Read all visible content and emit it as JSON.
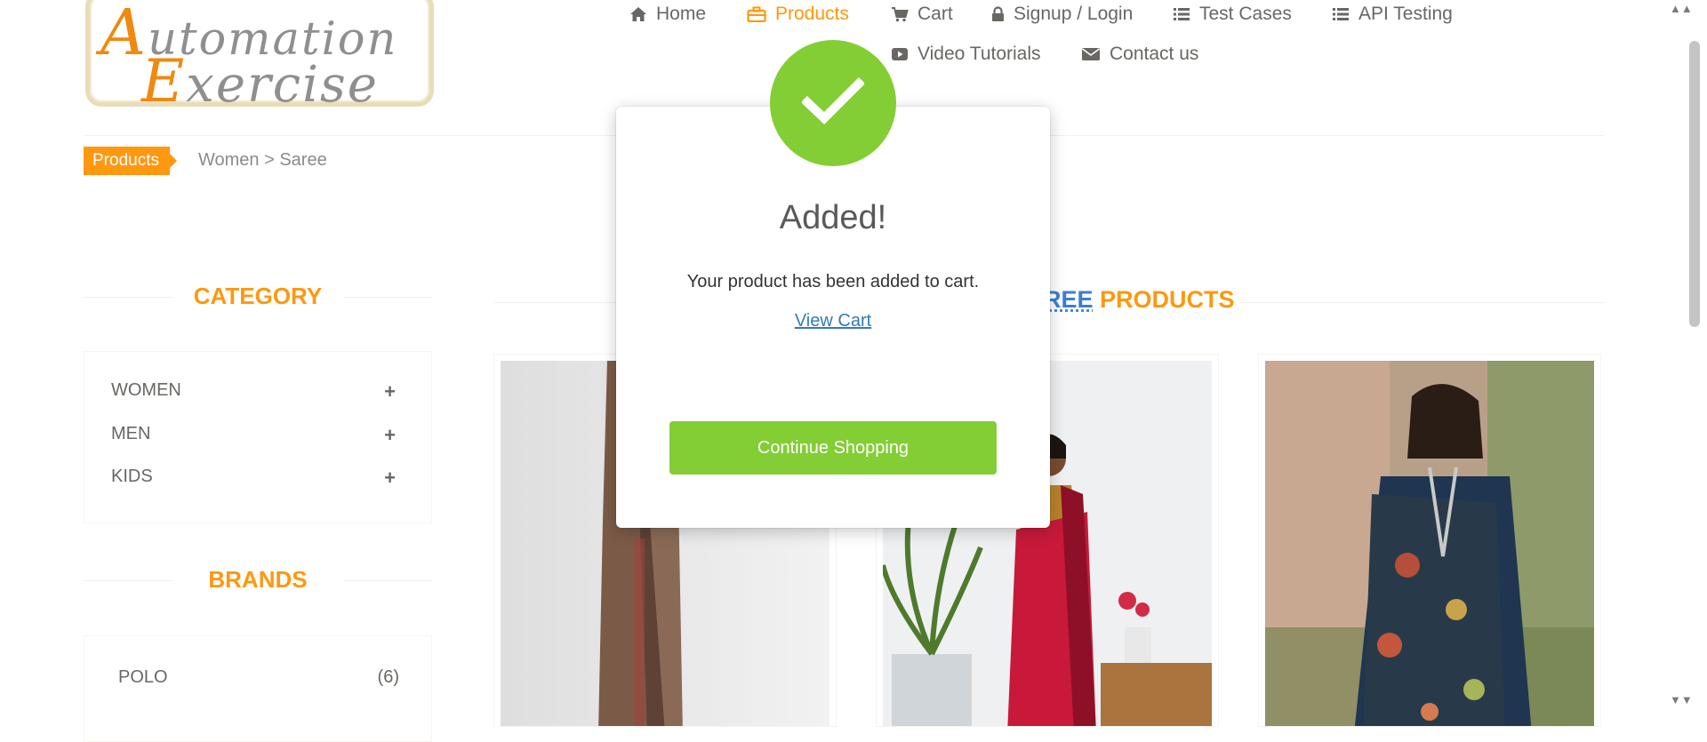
{
  "logo": {
    "line1": "Automation",
    "line2": "Exercise"
  },
  "nav": [
    {
      "id": "home",
      "label": "Home",
      "icon": "home-icon"
    },
    {
      "id": "products",
      "label": "Products",
      "icon": "briefcase-icon",
      "active": true
    },
    {
      "id": "cart",
      "label": "Cart",
      "icon": "cart-icon"
    },
    {
      "id": "signup",
      "label": "Signup / Login",
      "icon": "lock-icon"
    },
    {
      "id": "testcases",
      "label": "Test Cases",
      "icon": "list-icon"
    },
    {
      "id": "api",
      "label": "API Testing",
      "icon": "list-icon"
    },
    {
      "id": "video",
      "label": "Video Tutorials",
      "icon": "youtube-play-icon"
    },
    {
      "id": "contact",
      "label": "Contact us",
      "icon": "envelope-icon"
    }
  ],
  "breadcrumb": {
    "tag": "Products",
    "path": "Women > Saree"
  },
  "sidebar": {
    "category_title": "CATEGORY",
    "categories": [
      {
        "label": "WOMEN",
        "toggle": "+"
      },
      {
        "label": "MEN",
        "toggle": "+"
      },
      {
        "label": "KIDS",
        "toggle": "+"
      }
    ],
    "brands_title": "BRANDS",
    "brands": [
      {
        "label": "POLO",
        "count": "(6)"
      }
    ]
  },
  "main": {
    "title_highlight": "REE",
    "title_rest": " PRODUCTS"
  },
  "modal": {
    "title": "Added!",
    "message": "Your product has been added to cart.",
    "link_label": "View Cart",
    "button_label": "Continue Shopping",
    "icon": "checkmark-icon"
  },
  "colors": {
    "accent": "#fe980f",
    "success": "#83cd35",
    "link": "#337ab7",
    "text": "#696763"
  }
}
